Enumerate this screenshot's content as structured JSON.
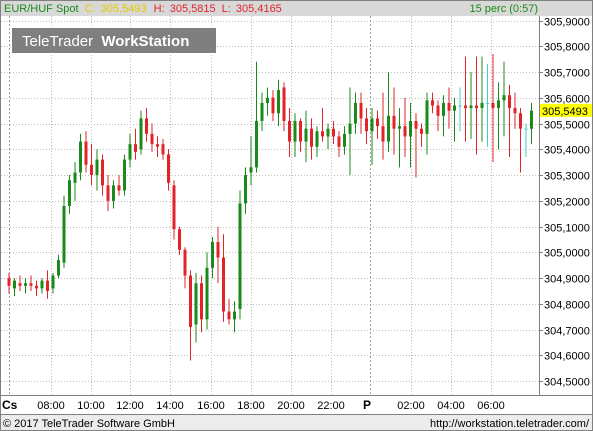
{
  "header": {
    "symbol": "EUR/HUF Spot",
    "close_label": "C:",
    "close_value": "305,5493",
    "high_label": "H:",
    "high_value": "305,5815",
    "low_label": "L:",
    "low_value": "305,4165",
    "interval": "15 perc (0:57)"
  },
  "watermark": {
    "brand_light": "TeleTrader",
    "brand_bold": "WorkStation"
  },
  "price_marker": "305,5493",
  "footer": {
    "copyright": "© 2017  TeleTrader Software GmbH",
    "url": "http://workstation.teletrader.com/"
  },
  "colors": {
    "up": "#1a8a1a",
    "down": "#e0242a",
    "doji": "#4dc8c8",
    "marker_bg": "#ffff00",
    "header_bg": "#d8d8d8",
    "grid": "#bdbdbd"
  },
  "chart_data": {
    "type": "candlestick",
    "ylim": [
      304.45,
      305.96
    ],
    "yticks": [
      "305,9000",
      "305,8000",
      "305,7000",
      "305,6000",
      "305,5000",
      "305,4000",
      "305,3000",
      "305,2000",
      "305,1000",
      "305,0000",
      "304,9000",
      "304,8000",
      "304,7000",
      "304,6000",
      "304,5000"
    ],
    "xticks": [
      {
        "label": "Cs",
        "bold": true
      },
      {
        "label": "08:00"
      },
      {
        "label": "10:00"
      },
      {
        "label": "12:00"
      },
      {
        "label": "14:00"
      },
      {
        "label": "16:00"
      },
      {
        "label": "18:00"
      },
      {
        "label": "20:00"
      },
      {
        "label": "22:00"
      },
      {
        "label": "P",
        "bold": true
      },
      {
        "label": "02:00"
      },
      {
        "label": "04:00"
      },
      {
        "label": "06:00"
      }
    ],
    "close": 305.5493,
    "candles": [
      {
        "o": 304.9,
        "h": 304.92,
        "l": 304.84,
        "c": 304.87
      },
      {
        "o": 304.86,
        "h": 304.9,
        "l": 304.83,
        "c": 304.89
      },
      {
        "o": 304.88,
        "h": 304.91,
        "l": 304.85,
        "c": 304.87
      },
      {
        "o": 304.87,
        "h": 304.9,
        "l": 304.84,
        "c": 304.88
      },
      {
        "o": 304.88,
        "h": 304.91,
        "l": 304.85,
        "c": 304.87
      },
      {
        "o": 304.87,
        "h": 304.89,
        "l": 304.83,
        "c": 304.86
      },
      {
        "o": 304.86,
        "h": 304.9,
        "l": 304.84,
        "c": 304.89
      },
      {
        "o": 304.89,
        "h": 304.93,
        "l": 304.82,
        "c": 304.85
      },
      {
        "o": 304.86,
        "h": 304.92,
        "l": 304.84,
        "c": 304.91
      },
      {
        "o": 304.91,
        "h": 304.99,
        "l": 304.9,
        "c": 304.97
      },
      {
        "o": 304.96,
        "h": 305.22,
        "l": 304.94,
        "c": 305.18
      },
      {
        "o": 305.18,
        "h": 305.3,
        "l": 305.15,
        "c": 305.28
      },
      {
        "o": 305.27,
        "h": 305.35,
        "l": 305.2,
        "c": 305.31
      },
      {
        "o": 305.31,
        "h": 305.46,
        "l": 305.28,
        "c": 305.43
      },
      {
        "o": 305.43,
        "h": 305.47,
        "l": 305.31,
        "c": 305.34
      },
      {
        "o": 305.34,
        "h": 305.42,
        "l": 305.26,
        "c": 305.3
      },
      {
        "o": 305.3,
        "h": 305.4,
        "l": 305.24,
        "c": 305.36
      },
      {
        "o": 305.36,
        "h": 305.38,
        "l": 305.22,
        "c": 305.26
      },
      {
        "o": 305.26,
        "h": 305.3,
        "l": 305.16,
        "c": 305.2
      },
      {
        "o": 305.2,
        "h": 305.28,
        "l": 305.17,
        "c": 305.26
      },
      {
        "o": 305.26,
        "h": 305.3,
        "l": 305.22,
        "c": 305.24
      },
      {
        "o": 305.24,
        "h": 305.38,
        "l": 305.22,
        "c": 305.36
      },
      {
        "o": 305.36,
        "h": 305.46,
        "l": 305.33,
        "c": 305.42
      },
      {
        "o": 305.42,
        "h": 305.48,
        "l": 305.36,
        "c": 305.39
      },
      {
        "o": 305.4,
        "h": 305.55,
        "l": 305.38,
        "c": 305.52
      },
      {
        "o": 305.52,
        "h": 305.56,
        "l": 305.43,
        "c": 305.46
      },
      {
        "o": 305.46,
        "h": 305.5,
        "l": 305.39,
        "c": 305.42
      },
      {
        "o": 305.42,
        "h": 305.45,
        "l": 305.37,
        "c": 305.41
      },
      {
        "o": 305.42,
        "h": 305.44,
        "l": 305.36,
        "c": 305.38
      },
      {
        "o": 305.38,
        "h": 305.4,
        "l": 305.24,
        "c": 305.27
      },
      {
        "o": 305.26,
        "h": 305.28,
        "l": 305.05,
        "c": 305.09
      },
      {
        "o": 305.09,
        "h": 305.1,
        "l": 304.99,
        "c": 305.01
      },
      {
        "o": 305.01,
        "h": 305.02,
        "l": 304.86,
        "c": 304.91
      },
      {
        "o": 304.91,
        "h": 304.93,
        "l": 304.58,
        "c": 304.71
      },
      {
        "o": 304.72,
        "h": 304.92,
        "l": 304.65,
        "c": 304.88
      },
      {
        "o": 304.88,
        "h": 304.91,
        "l": 304.69,
        "c": 304.74
      },
      {
        "o": 304.74,
        "h": 305.0,
        "l": 304.7,
        "c": 304.94
      },
      {
        "o": 304.94,
        "h": 305.06,
        "l": 304.9,
        "c": 305.04
      },
      {
        "o": 305.04,
        "h": 305.1,
        "l": 304.88,
        "c": 304.98
      },
      {
        "o": 304.98,
        "h": 305.07,
        "l": 304.73,
        "c": 304.77
      },
      {
        "o": 304.77,
        "h": 304.82,
        "l": 304.72,
        "c": 304.74
      },
      {
        "o": 304.74,
        "h": 304.81,
        "l": 304.69,
        "c": 304.77
      },
      {
        "o": 304.78,
        "h": 305.24,
        "l": 304.74,
        "c": 305.19
      },
      {
        "o": 305.19,
        "h": 305.33,
        "l": 305.15,
        "c": 305.3
      },
      {
        "o": 305.31,
        "h": 305.45,
        "l": 305.26,
        "c": 305.33
      },
      {
        "o": 305.33,
        "h": 305.74,
        "l": 305.31,
        "c": 305.51
      },
      {
        "o": 305.51,
        "h": 305.62,
        "l": 305.47,
        "c": 305.58
      },
      {
        "o": 305.58,
        "h": 305.64,
        "l": 305.53,
        "c": 305.6
      },
      {
        "o": 305.6,
        "h": 305.63,
        "l": 305.51,
        "c": 305.54
      },
      {
        "o": 305.54,
        "h": 305.67,
        "l": 305.49,
        "c": 305.63
      },
      {
        "o": 305.64,
        "h": 305.66,
        "l": 305.47,
        "c": 305.51
      },
      {
        "o": 305.51,
        "h": 305.56,
        "l": 305.37,
        "c": 305.43
      },
      {
        "o": 305.43,
        "h": 305.54,
        "l": 305.37,
        "c": 305.51
      },
      {
        "o": 305.51,
        "h": 305.52,
        "l": 305.39,
        "c": 305.43
      },
      {
        "o": 305.43,
        "h": 305.55,
        "l": 305.35,
        "c": 305.48
      },
      {
        "o": 305.48,
        "h": 305.52,
        "l": 305.36,
        "c": 305.41
      },
      {
        "o": 305.41,
        "h": 305.49,
        "l": 305.37,
        "c": 305.47
      },
      {
        "o": 305.47,
        "h": 305.56,
        "l": 305.43,
        "c": 305.45
      },
      {
        "o": 305.45,
        "h": 305.5,
        "l": 305.4,
        "c": 305.48
      },
      {
        "o": 305.48,
        "h": 305.51,
        "l": 305.42,
        "c": 305.45
      },
      {
        "o": 305.45,
        "h": 305.47,
        "l": 305.37,
        "c": 305.41
      },
      {
        "o": 305.41,
        "h": 305.49,
        "l": 305.38,
        "c": 305.46
      },
      {
        "o": 305.46,
        "h": 305.64,
        "l": 305.3,
        "c": 305.5
      },
      {
        "o": 305.5,
        "h": 305.62,
        "l": 305.46,
        "c": 305.58
      },
      {
        "o": 305.58,
        "h": 305.62,
        "l": 305.46,
        "c": 305.52
      },
      {
        "o": 305.52,
        "h": 305.56,
        "l": 305.42,
        "c": 305.47
      },
      {
        "o": 305.47,
        "h": 305.56,
        "l": 305.34,
        "c": 305.52
      },
      {
        "o": 305.52,
        "h": 305.55,
        "l": 305.44,
        "c": 305.49
      },
      {
        "o": 305.49,
        "h": 305.62,
        "l": 305.36,
        "c": 305.43
      },
      {
        "o": 305.43,
        "h": 305.7,
        "l": 305.39,
        "c": 305.53
      },
      {
        "o": 305.53,
        "h": 305.64,
        "l": 305.38,
        "c": 305.48
      },
      {
        "o": 305.48,
        "h": 305.56,
        "l": 305.33,
        "c": 305.49
      },
      {
        "o": 305.49,
        "h": 305.6,
        "l": 305.37,
        "c": 305.45
      },
      {
        "o": 305.45,
        "h": 305.58,
        "l": 305.33,
        "c": 305.51
      },
      {
        "o": 305.51,
        "h": 305.54,
        "l": 305.29,
        "c": 305.48
      },
      {
        "o": 305.48,
        "h": 305.5,
        "l": 305.41,
        "c": 305.46
      },
      {
        "o": 305.46,
        "h": 305.62,
        "l": 305.38,
        "c": 305.59
      },
      {
        "o": 305.59,
        "h": 305.62,
        "l": 305.54,
        "c": 305.57
      },
      {
        "o": 305.57,
        "h": 305.59,
        "l": 305.47,
        "c": 305.53
      },
      {
        "o": 305.53,
        "h": 305.61,
        "l": 305.45,
        "c": 305.58
      },
      {
        "o": 305.58,
        "h": 305.64,
        "l": 305.48,
        "c": 305.55
      },
      {
        "o": 305.55,
        "h": 305.6,
        "l": 305.43,
        "c": 305.57
      },
      {
        "o": 305.57,
        "h": 305.64,
        "l": 305.47,
        "c": 305.57
      },
      {
        "o": 305.57,
        "h": 305.76,
        "l": 305.43,
        "c": 305.56
      },
      {
        "o": 305.56,
        "h": 305.7,
        "l": 305.44,
        "c": 305.57
      },
      {
        "o": 305.57,
        "h": 305.76,
        "l": 305.38,
        "c": 305.56
      },
      {
        "o": 305.56,
        "h": 305.76,
        "l": 305.43,
        "c": 305.58
      },
      {
        "o": 305.58,
        "h": 305.73,
        "l": 305.41,
        "c": 305.58
      },
      {
        "o": 305.58,
        "h": 305.77,
        "l": 305.35,
        "c": 305.56
      },
      {
        "o": 305.56,
        "h": 305.66,
        "l": 305.4,
        "c": 305.59
      },
      {
        "o": 305.59,
        "h": 305.74,
        "l": 305.45,
        "c": 305.61
      },
      {
        "o": 305.61,
        "h": 305.65,
        "l": 305.37,
        "c": 305.56
      },
      {
        "o": 305.56,
        "h": 305.62,
        "l": 305.48,
        "c": 305.54
      },
      {
        "o": 305.54,
        "h": 305.56,
        "l": 305.31,
        "c": 305.48
      },
      {
        "o": 305.48,
        "h": 305.5,
        "l": 305.37,
        "c": 305.48
      },
      {
        "o": 305.48,
        "h": 305.58,
        "l": 305.42,
        "c": 305.55
      }
    ]
  }
}
